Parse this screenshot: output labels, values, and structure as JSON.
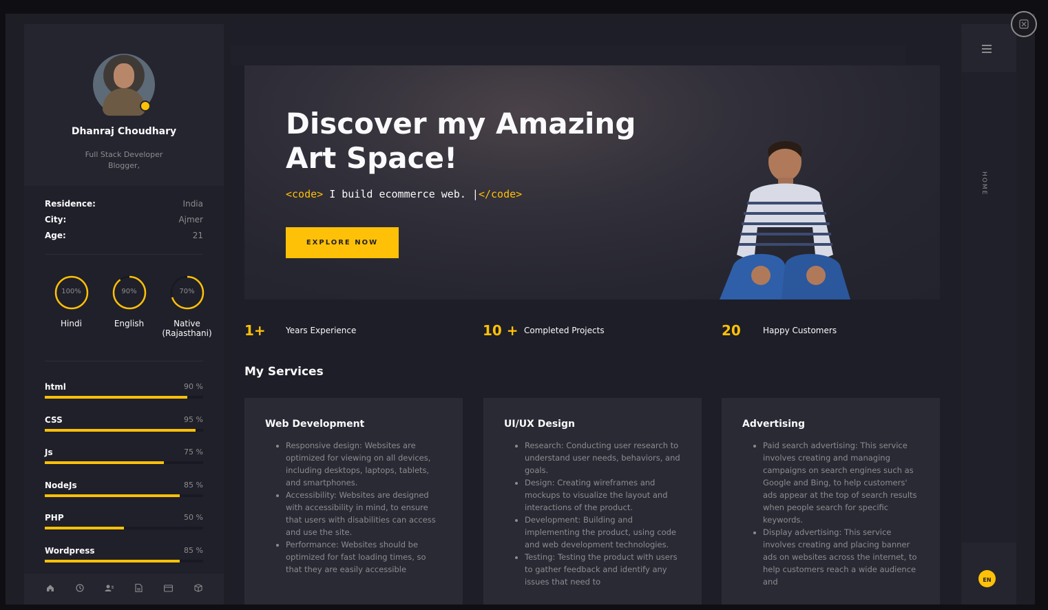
{
  "profile": {
    "name": "Dhanraj Choudhary",
    "role_line1": "Full Stack Developer",
    "role_line2": "Blogger,"
  },
  "info": [
    {
      "key": "Residence:",
      "value": "India"
    },
    {
      "key": "City:",
      "value": "Ajmer"
    },
    {
      "key": "Age:",
      "value": "21"
    }
  ],
  "languages": [
    {
      "name": "Hindi",
      "percent": 100,
      "label": "100%"
    },
    {
      "name": "English",
      "percent": 90,
      "label": "90%"
    },
    {
      "name": "Native\n(Rajasthani)",
      "percent": 70,
      "label": "70%"
    }
  ],
  "skills": [
    {
      "name": "html",
      "percent": 90,
      "label": "90 %"
    },
    {
      "name": "CSS",
      "percent": 95,
      "label": "95 %"
    },
    {
      "name": "Js",
      "percent": 75,
      "label": "75 %"
    },
    {
      "name": "NodeJs",
      "percent": 85,
      "label": "85 %"
    },
    {
      "name": "PHP",
      "percent": 50,
      "label": "50 %"
    },
    {
      "name": "Wordpress",
      "percent": 85,
      "label": "85 %"
    }
  ],
  "footer_icons": [
    "home-icon",
    "history-icon",
    "contacts-icon",
    "document-icon",
    "mail-icon",
    "box-icon"
  ],
  "hero": {
    "title": "Discover my Amazing Art Space!",
    "code_open": "<code>",
    "code_text": " I build ecommerce web. |",
    "code_close": "</code>",
    "button": "EXPLORE NOW"
  },
  "stats": [
    {
      "number": "1+",
      "label": "Years Experience"
    },
    {
      "number": "10 +",
      "label": "Completed Projects"
    },
    {
      "number": "20",
      "label": "Happy Customers"
    }
  ],
  "services": {
    "title": "My Services",
    "cards": [
      {
        "title": "Web Development",
        "items": [
          "Responsive design: Websites are optimized for viewing on all devices, including desktops, laptops, tablets, and smartphones.",
          "Accessibility: Websites are designed with accessibility in mind, to ensure that users with disabilities can access and use the site.",
          "Performance: Websites should be optimized for fast loading times, so that they are easily accessible"
        ]
      },
      {
        "title": "UI/UX Design",
        "items": [
          "Research: Conducting user research to understand user needs, behaviors, and goals.",
          "Design: Creating wireframes and mockups to visualize the layout and interactions of the product.",
          "Development: Building and implementing the product, using code and web development technologies.",
          "Testing: Testing the product with users to gather feedback and identify any issues that need to"
        ]
      },
      {
        "title": "Advertising",
        "items": [
          "Paid search advertising: This service involves creating and managing campaigns on search engines such as Google and Bing, to help customers' ads appear at the top of search results when people search for specific keywords.",
          "Display advertising: This service involves creating and placing banner ads on websites across the internet, to help customers reach a wide audience and"
        ]
      }
    ]
  },
  "rail": {
    "nav_label": "HOME",
    "lang": "EN"
  },
  "colors": {
    "accent": "#ffc107",
    "background": "#1e1e26",
    "panel": "#2a2a35",
    "text_primary": "#fafafc",
    "text_muted": "#8c8c8e"
  }
}
